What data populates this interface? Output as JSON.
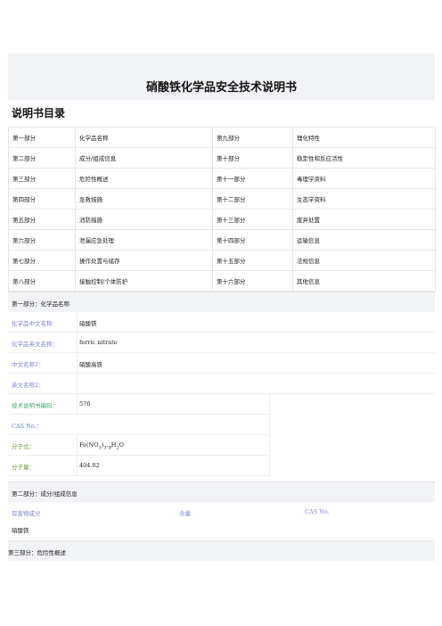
{
  "title": "硝酸铁化学品安全技术说明书",
  "toc_heading": "说明书目录",
  "toc": [
    [
      "第一部分",
      "化学品名称",
      "第九部分",
      "理化特性"
    ],
    [
      "第二部分",
      "成分/组成信息",
      "第十部分",
      "稳定性和反应活性"
    ],
    [
      "第三部分",
      "危险性概述",
      "第十一部分",
      "毒理学资料"
    ],
    [
      "第四部分",
      "急救措施",
      "第十二部分",
      "生态学资料"
    ],
    [
      "第五部分",
      "消防措施",
      "第十三部分",
      "废弃处置"
    ],
    [
      "第六部分",
      "泄漏应急处理",
      "第十四部分",
      "运输信息"
    ],
    [
      "第七部分",
      "操作处置与储存",
      "第十五部分",
      "法规信息"
    ],
    [
      "第八部分",
      "接触控制/个体防护",
      "第十六部分",
      "其他信息"
    ]
  ],
  "section1": {
    "header": "第一部分：化学品名称",
    "fields": [
      {
        "label": "化学品中文名称：",
        "value": "硝酸铁"
      },
      {
        "label": "化学品英文名称：",
        "value": "ferric nitrate"
      },
      {
        "label": "中文名称2：",
        "value": "硝酸高铁"
      },
      {
        "label": "英文名称2：",
        "value": ""
      },
      {
        "label": "技术说明书编码：",
        "value": "576"
      },
      {
        "label": "CAS No.：",
        "value": ""
      },
      {
        "label": "分子式：",
        "value": "Fe(NO3)3.9H2O"
      },
      {
        "label": "分子量：",
        "value": "404.02"
      }
    ]
  },
  "section2": {
    "header": "第二部分：成分/组成信息",
    "col_harmful": "有害物成分",
    "col_content": "含量",
    "col_cas": "CAS No.",
    "row_value": "硝酸铁"
  },
  "section3": {
    "header": "第三部分：危险性概述"
  }
}
